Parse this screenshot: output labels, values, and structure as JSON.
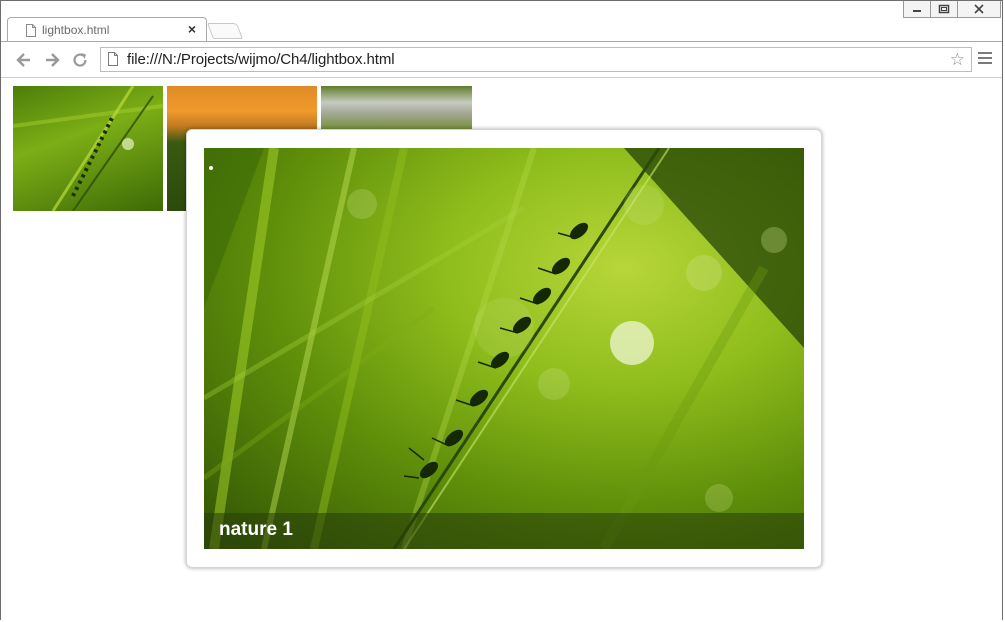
{
  "tab": {
    "title": "lightbox.html",
    "close_glyph": "×"
  },
  "window_controls": {
    "minimize": "minimize-icon",
    "maximize": "maximize-icon",
    "close": "close-icon"
  },
  "toolbar": {
    "url": "file:///N:/Projects/wijmo/Ch4/lightbox.html",
    "back_icon": "back-arrow-icon",
    "forward_icon": "forward-arrow-icon",
    "reload_icon": "reload-icon",
    "star_glyph": "☆",
    "menu_icon": "menu-icon"
  },
  "gallery": {
    "thumbnails": [
      "nature-thumbnail-1",
      "nature-thumbnail-2",
      "nature-thumbnail-3"
    ]
  },
  "lightbox": {
    "caption": "nature 1"
  },
  "colors": {
    "caption_bg": "#283c0a",
    "frame_border": "#d4d4d4",
    "caption_text": "#ffffff"
  }
}
